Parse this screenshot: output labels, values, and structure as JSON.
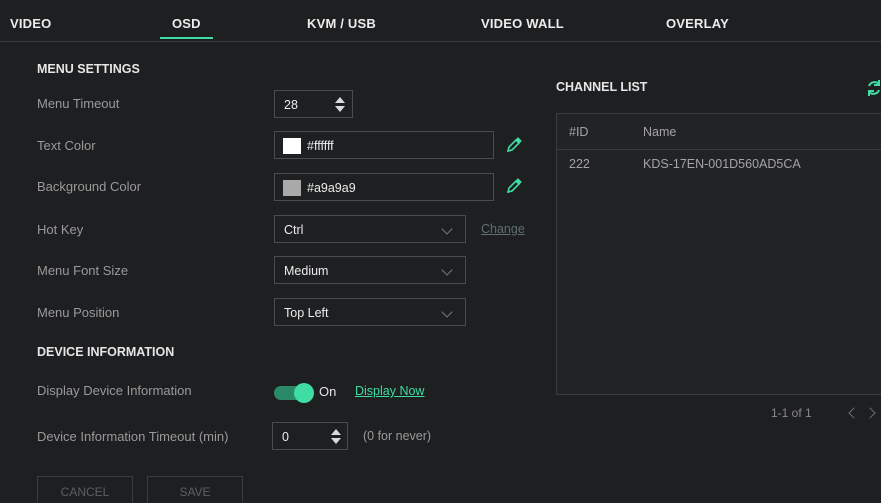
{
  "tabs": [
    {
      "label": "VIDEO"
    },
    {
      "label": "OSD"
    },
    {
      "label": "KVM / USB"
    },
    {
      "label": "VIDEO WALL"
    },
    {
      "label": "OVERLAY"
    }
  ],
  "active_tab": "OSD",
  "menu_settings": {
    "title": "MENU SETTINGS",
    "menu_timeout": {
      "label": "Menu Timeout",
      "value": "28"
    },
    "text_color": {
      "label": "Text Color",
      "value": "#ffffff",
      "swatch": "#ffffff"
    },
    "background_color": {
      "label": "Background Color",
      "value": "#a9a9a9",
      "swatch": "#a9a9a9"
    },
    "hot_key": {
      "label": "Hot Key",
      "value": "Ctrl",
      "change_label": "Change"
    },
    "menu_font_size": {
      "label": "Menu Font Size",
      "value": "Medium"
    },
    "menu_position": {
      "label": "Menu Position",
      "value": "Top Left"
    }
  },
  "device_information": {
    "title": "DEVICE INFORMATION",
    "display_device_info": {
      "label": "Display Device Information",
      "toggle_state": "On",
      "display_now_label": "Display Now"
    },
    "timeout": {
      "label": "Device Information Timeout (min)",
      "value": "0",
      "hint": "(0 for never)"
    }
  },
  "buttons": {
    "cancel": "CANCEL",
    "save": "SAVE"
  },
  "channel_list": {
    "title": "CHANNEL LIST",
    "columns": [
      "#ID",
      "Name"
    ],
    "rows": [
      {
        "id": "222",
        "name": "KDS-17EN-001D560AD5CA"
      }
    ],
    "pagination": "1-1 of 1"
  },
  "colors": {
    "accent": "#3fdca3",
    "background": "#1e1f21"
  }
}
